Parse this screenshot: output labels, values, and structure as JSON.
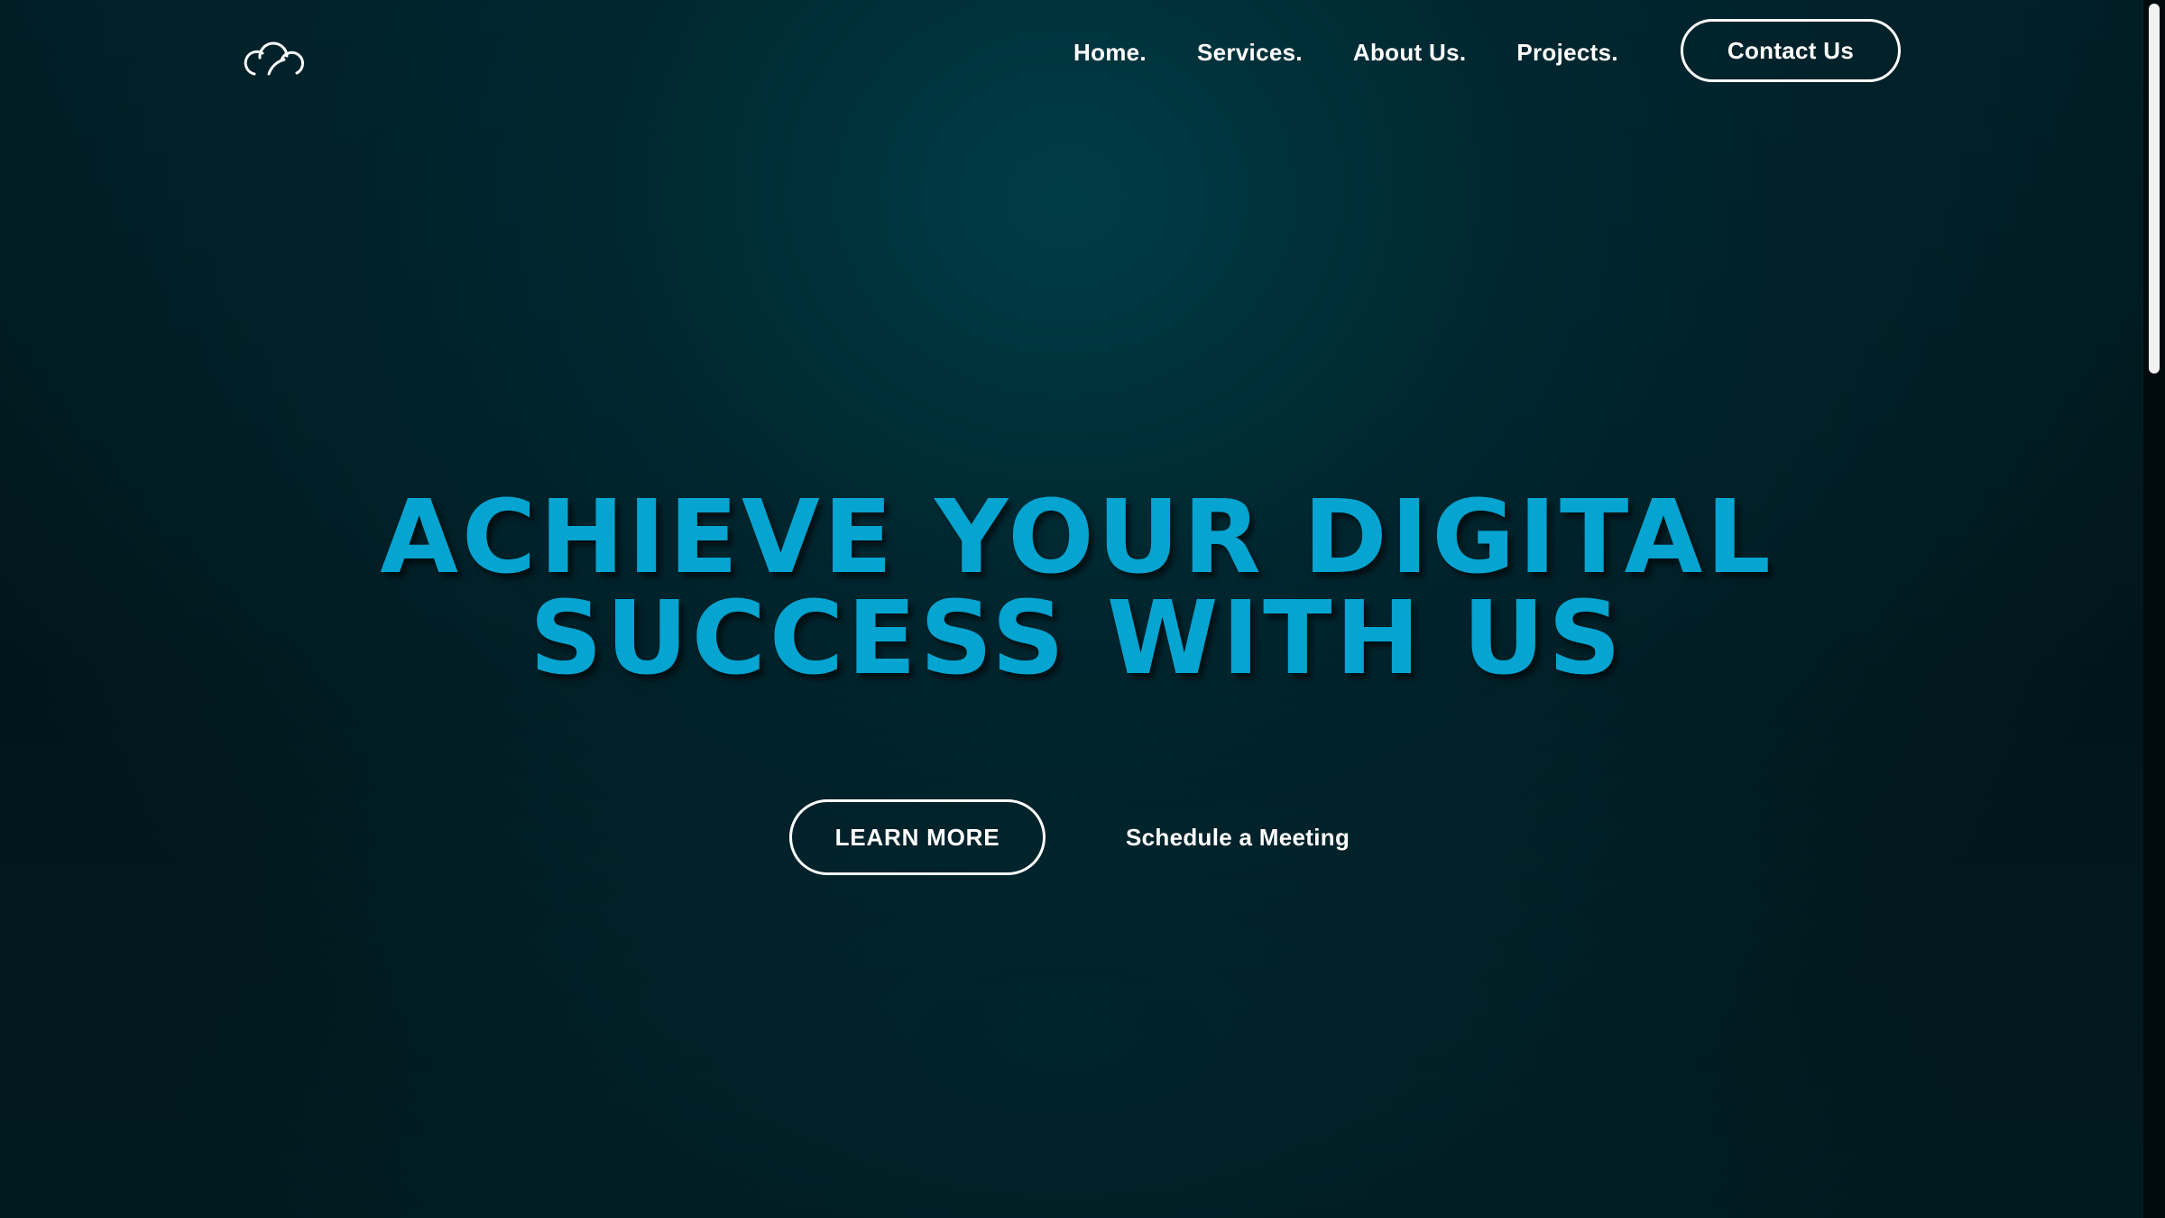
{
  "header": {
    "logo_icon": "cloud-icon",
    "nav": {
      "home": "Home.",
      "services": "Services.",
      "about": "About Us.",
      "projects": "Projects."
    },
    "contact_label": "Contact Us"
  },
  "hero": {
    "title_line_1": "ACHIEVE YOUR DIGITAL",
    "title_line_2": "SUCCESS WITH US",
    "learn_more_label": "LEARN MORE",
    "schedule_label": "Schedule a Meeting"
  },
  "colors": {
    "accent": "#06a4d0",
    "background": "#011d24",
    "text": "#ffffff"
  }
}
